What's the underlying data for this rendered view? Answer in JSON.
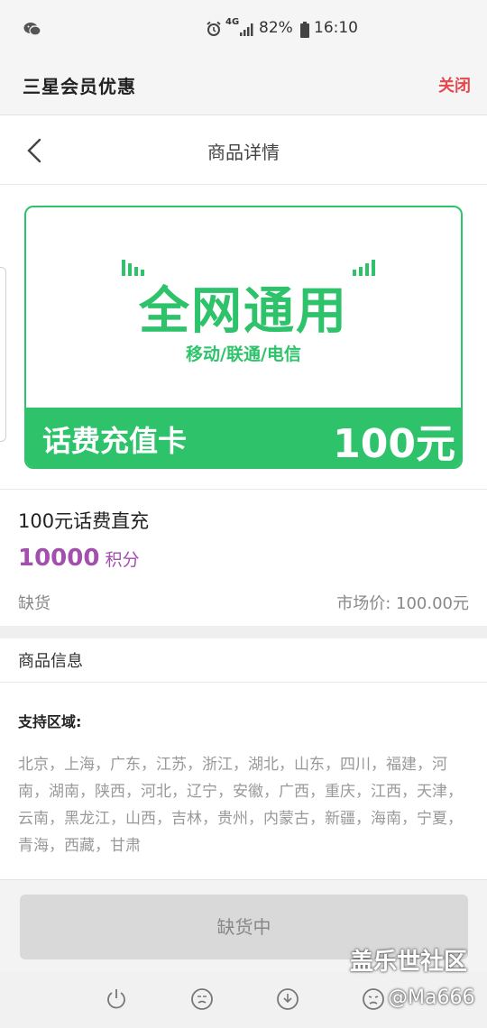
{
  "status_bar": {
    "network": "4G",
    "battery": "82%",
    "time": "16:10"
  },
  "app_header": {
    "title": "三星会员优惠",
    "close_label": "关闭"
  },
  "nav": {
    "page_title": "商品详情"
  },
  "hero_card": {
    "headline": "全网通用",
    "carriers": "移动/联通/电信",
    "card_label": "话费充值卡",
    "amount": "100元"
  },
  "product": {
    "name": "100元话费直充",
    "points_value": "10000",
    "points_unit": "积分",
    "stock_status": "缺货",
    "market_price": "市场价: 100.00元"
  },
  "info": {
    "section_title": "商品信息",
    "support_title": "支持区域:",
    "regions": "北京，上海，广东，江苏，浙江，湖北，山东，四川，福建，河南，湖南，陕西，河北，辽宁，安徽，广西，重庆，江西，天津，云南，黑龙江，山西，吉林，贵州，内蒙古，新疆，海南，宁夏，青海，西藏，甘肃"
  },
  "action": {
    "button_label": "缺货中"
  },
  "watermark": {
    "line1": "盖乐世社区",
    "line2": "@Ma666"
  },
  "colors": {
    "accent_green": "#2ec36b",
    "points_purple": "#a24fae",
    "close_red": "#e5484d"
  }
}
